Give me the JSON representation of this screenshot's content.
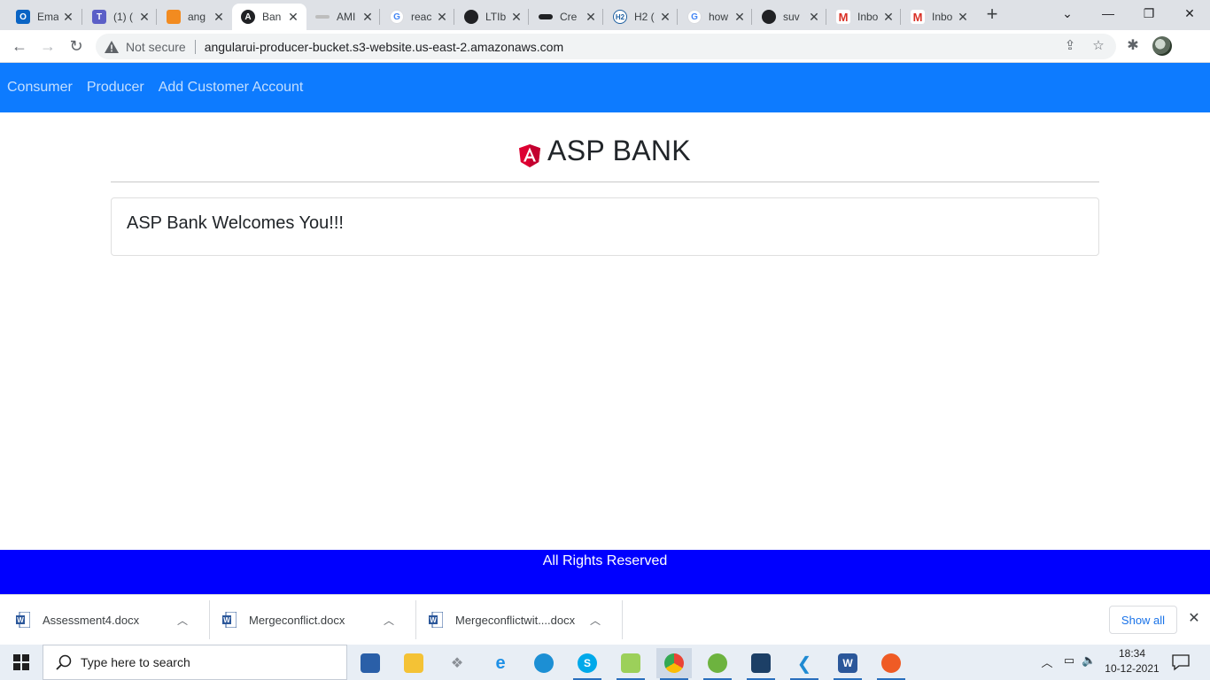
{
  "browser": {
    "tabs": [
      {
        "title": "Ema",
        "favicon": "outlook-icon",
        "color": "#0a64c4"
      },
      {
        "title": "(1) (",
        "favicon": "teams-icon",
        "color": "#5b5fc7"
      },
      {
        "title": "ang",
        "favicon": "box-icon",
        "color": "#f28b20"
      },
      {
        "title": "Ban",
        "favicon": "angular-icon",
        "color": "#202124",
        "active": true
      },
      {
        "title": "AMI",
        "favicon": "aws-icon",
        "color": "#999999"
      },
      {
        "title": "reac",
        "favicon": "google-icon",
        "color": "#4285f4"
      },
      {
        "title": "LTIb",
        "favicon": "github-icon",
        "color": "#202124"
      },
      {
        "title": "Cre",
        "favicon": "dash-icon",
        "color": "#202124"
      },
      {
        "title": "H2 (",
        "favicon": "h2-icon",
        "color": "#1d5fa0"
      },
      {
        "title": "how",
        "favicon": "google-icon",
        "color": "#4285f4"
      },
      {
        "title": "suv",
        "favicon": "github-icon",
        "color": "#202124"
      },
      {
        "title": "Inbo",
        "favicon": "gmail-icon",
        "color": "#d93025"
      },
      {
        "title": "Inbo",
        "favicon": "gmail-icon",
        "color": "#d93025"
      }
    ],
    "security_label": "Not secure",
    "url": "angularui-producer-bucket.s3-website.us-east-2.amazonaws.com"
  },
  "nav": {
    "links": [
      "Consumer",
      "Producer",
      "Add Customer Account"
    ]
  },
  "header": {
    "title": "ASP BANK"
  },
  "card": {
    "message": "ASP Bank Welcomes You!!!"
  },
  "footer": {
    "text": "All Rights Reserved"
  },
  "downloads": {
    "items": [
      "Assessment4.docx",
      "Mergeconflict.docx",
      "Mergeconflictwit....docx"
    ],
    "show_all": "Show all"
  },
  "taskbar": {
    "search_placeholder": "Type here to search",
    "time": "18:34",
    "date": "10-12-2021"
  },
  "colors": {
    "nav_bg": "#0d7bff",
    "footer_bg": "#0000ff",
    "angular_red": "#dd0031"
  }
}
